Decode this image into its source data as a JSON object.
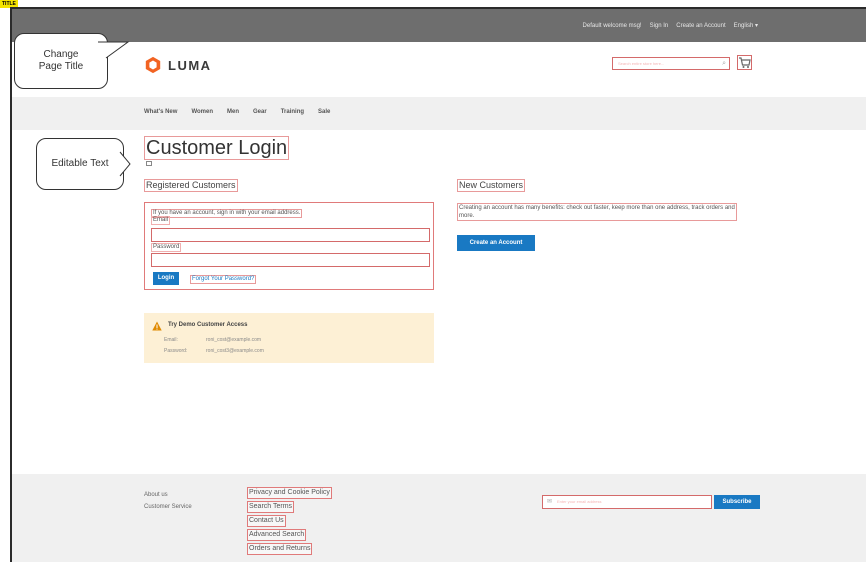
{
  "page_tag": "TITLE",
  "topbar": {
    "welcome": "Default welcome msg!",
    "sign_in": "Sign In",
    "create_account": "Create an Account",
    "language": "English ▾"
  },
  "header": {
    "logo_text": "LUMA",
    "search_placeholder": "Search entire store here...",
    "search_icon": "magnifier-icon",
    "cart_icon": "cart-icon"
  },
  "nav": {
    "items": [
      "What's New",
      "Women",
      "Men",
      "Gear",
      "Training",
      "Sale"
    ]
  },
  "callouts": {
    "change_title": "Change\nPage Title",
    "editable_text": "Editable Text"
  },
  "main": {
    "page_title": "Customer Login",
    "registered": {
      "title": "Registered Customers",
      "intro": "If you have an account, sign in with your email address.",
      "email_label": "Email",
      "password_label": "Password",
      "login_button": "Login",
      "forgot_link": "Forgot Your Password?"
    },
    "new_customers": {
      "title": "New Customers",
      "text": "Creating an account has many benefits: check out faster, keep more than one address, track orders and more.",
      "create_button": "Create an Account"
    },
    "demo": {
      "title": "Try Demo Customer Access",
      "email_label": "Email:",
      "email_value": "roni_cost@example.com",
      "password_label": "Password:",
      "password_value": "roni_cost3@example.com"
    }
  },
  "footer": {
    "col1": [
      "About us",
      "Customer Service"
    ],
    "col2": [
      "Privacy and Cookie Policy",
      "Search Terms",
      "Contact Us",
      "Advanced Search",
      "Orders and Returns"
    ],
    "newsletter_placeholder": "Enter your email address",
    "subscribe_button": "Subscribe"
  },
  "colors": {
    "primary_button": "#1979c3",
    "outline_red": "#d46a6a",
    "topbar": "#6e6e6e",
    "demo_bg": "#fdf0d5"
  }
}
